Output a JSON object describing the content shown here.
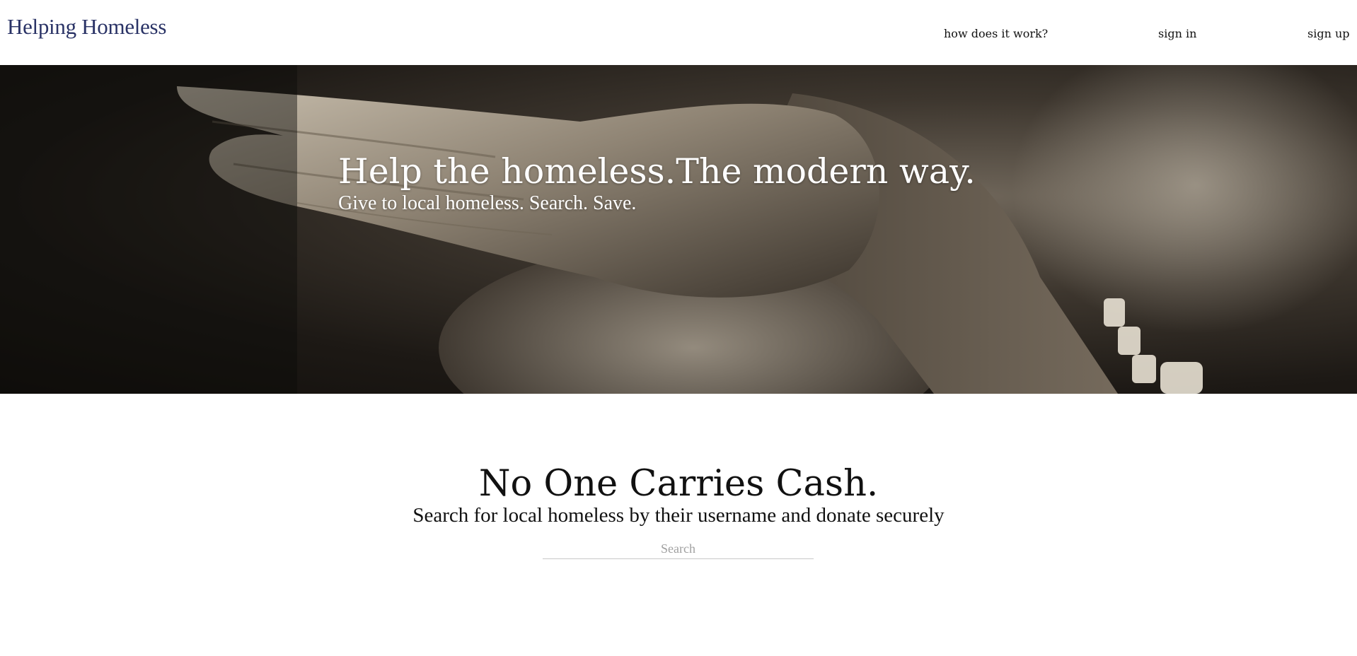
{
  "header": {
    "logo": "Helping Homeless",
    "nav": {
      "how_it_works": "how does it work?",
      "sign_in": "sign in",
      "sign_up": "sign up"
    }
  },
  "hero": {
    "title": "Help the homeless.The modern way.",
    "subtitle": "Give to local homeless. Search. Save.",
    "image": "sepia photo of an open outstretched hand with bracelet"
  },
  "main": {
    "title": "No One Carries Cash.",
    "subtitle": "Search for local homeless by their username and donate securely",
    "search": {
      "placeholder": "Search",
      "value": ""
    }
  },
  "colors": {
    "logo": "#2a3366",
    "text": "#111111",
    "hero_text": "#ffffff",
    "placeholder": "#a0a0a0",
    "search_underline": "#c8c8c8"
  }
}
